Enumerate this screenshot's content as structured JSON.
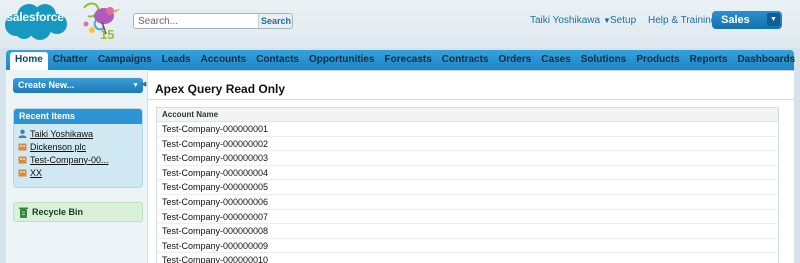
{
  "header": {
    "logo_text": "salesforce",
    "anniversary_number": "15",
    "search": {
      "placeholder": "Search...",
      "button_label": "Search"
    },
    "user_name": "Taiki Yoshikawa",
    "setup_label": "Setup",
    "help_label": "Help & Training",
    "app_label": "Sales"
  },
  "tabs": [
    {
      "label": "Home"
    },
    {
      "label": "Chatter"
    },
    {
      "label": "Campaigns"
    },
    {
      "label": "Leads"
    },
    {
      "label": "Accounts"
    },
    {
      "label": "Contacts"
    },
    {
      "label": "Opportunities"
    },
    {
      "label": "Forecasts"
    },
    {
      "label": "Contracts"
    },
    {
      "label": "Orders"
    },
    {
      "label": "Cases"
    },
    {
      "label": "Solutions"
    },
    {
      "label": "Products"
    },
    {
      "label": "Reports"
    },
    {
      "label": "Dashboards"
    },
    {
      "label": "+"
    }
  ],
  "sidebar": {
    "create_new_label": "Create New...",
    "recent_items_title": "Recent Items",
    "recent_items": [
      {
        "label": "Taiki Yoshikawa",
        "icon": "user-icon"
      },
      {
        "label": "Dickenson plc",
        "icon": "account-icon"
      },
      {
        "label": "Test-Company-00...",
        "icon": "account-icon"
      },
      {
        "label": "XX",
        "icon": "account-icon"
      }
    ],
    "recycle_bin_label": "Recycle Bin"
  },
  "main": {
    "title": "Apex Query Read Only",
    "table": {
      "column_header": "Account Name",
      "rows": [
        "Test-Company-000000001",
        "Test-Company-000000002",
        "Test-Company-000000003",
        "Test-Company-000000004",
        "Test-Company-000000005",
        "Test-Company-000000006",
        "Test-Company-000000007",
        "Test-Company-000000008",
        "Test-Company-000000009",
        "Test-Company-000000010"
      ]
    }
  },
  "colors": {
    "tab_bar": "#1e87c6",
    "app_switcher": "#1670ae",
    "recent_panel": "#cfe8f2",
    "recycle_bin": "#d9f0d9"
  }
}
